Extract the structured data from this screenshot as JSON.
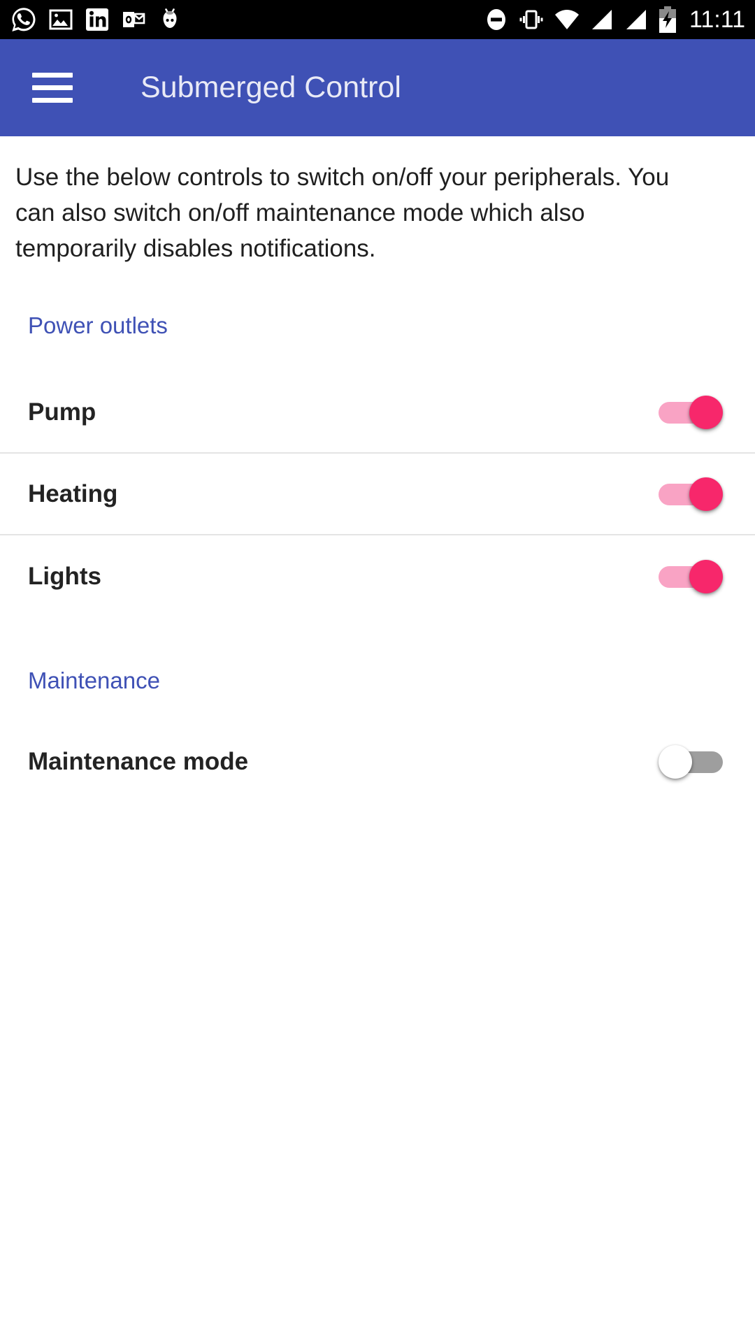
{
  "statusbar": {
    "time": "11:11",
    "left_icons": [
      {
        "name": "whatsapp-icon",
        "label": "WhatsApp"
      },
      {
        "name": "gallery-icon",
        "label": "Gallery"
      },
      {
        "name": "linkedin-icon",
        "label": "LinkedIn"
      },
      {
        "name": "outlook-icon",
        "label": "Outlook"
      },
      {
        "name": "cyanogenmod-icon",
        "label": "CyanogenMod"
      }
    ],
    "right_icons": [
      {
        "name": "do-not-disturb-icon",
        "label": "Do not disturb"
      },
      {
        "name": "vibrate-icon",
        "label": "Vibrate"
      },
      {
        "name": "wifi-icon",
        "label": "Wi-Fi"
      },
      {
        "name": "signal-sim1-icon",
        "label": "Signal SIM 1"
      },
      {
        "name": "signal-sim2-icon",
        "label": "Signal SIM 2"
      },
      {
        "name": "battery-charging-icon",
        "label": "Battery charging"
      }
    ]
  },
  "appbar": {
    "title": "Submerged Control",
    "menu_icon": "hamburger-menu-icon"
  },
  "main": {
    "intro": "Use the below controls to switch on/off your peripherals. You can also switch on/off maintenance mode which also temporarily disables notifications.",
    "sections": [
      {
        "header": "Power outlets",
        "rows": [
          {
            "label": "Pump",
            "state": "on"
          },
          {
            "label": "Heating",
            "state": "on"
          },
          {
            "label": "Lights",
            "state": "on"
          }
        ]
      },
      {
        "header": "Maintenance",
        "rows": [
          {
            "label": "Maintenance mode",
            "state": "off"
          }
        ]
      }
    ]
  },
  "colors": {
    "appbar": "#3F51B5",
    "accent_header": "#3F51B5",
    "switch_on_thumb": "#F7276B",
    "switch_on_track": "#F9A3C4",
    "switch_off_track": "#9E9E9E",
    "switch_off_thumb": "#FFFFFF",
    "statusbar": "#000000"
  }
}
